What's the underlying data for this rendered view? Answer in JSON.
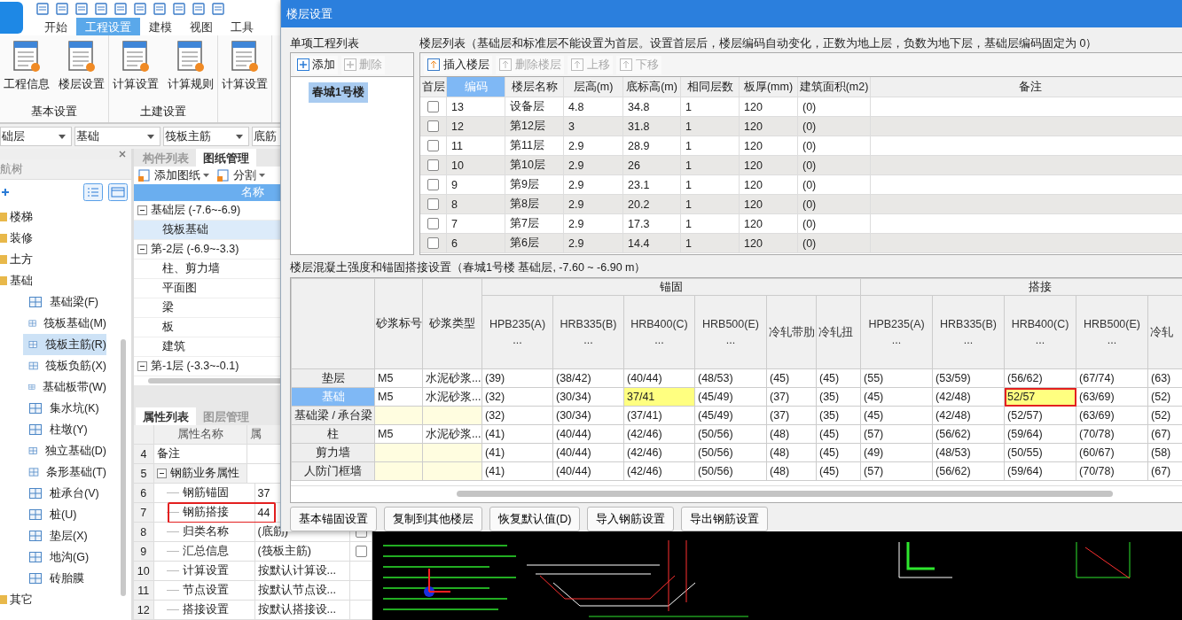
{
  "ribbon_tabs": [
    {
      "label": "开始",
      "selected": false
    },
    {
      "label": "工程设置",
      "selected": true
    },
    {
      "label": "建模",
      "selected": false
    },
    {
      "label": "视图",
      "selected": false
    },
    {
      "label": "工具",
      "selected": false
    }
  ],
  "ribbon_groups": [
    {
      "title": "基本设置",
      "buttons": [
        "工程信息",
        "楼层设置"
      ]
    },
    {
      "title": "土建设置",
      "buttons": [
        "计算设置",
        "计算规则"
      ]
    },
    {
      "buttons": [
        "计算设置"
      ]
    }
  ],
  "selectors": [
    "础层",
    "基础",
    "筏板主筋",
    "底筋"
  ],
  "nav_tree": {
    "title": "航树",
    "items": [
      {
        "label": "楼梯"
      },
      {
        "label": "装修"
      },
      {
        "label": "土方"
      },
      {
        "label": "基础",
        "children": [
          {
            "label": "基础梁(F)",
            "selected": false
          },
          {
            "label": "筏板基础(M)",
            "selected": false
          },
          {
            "label": "筏板主筋(R)",
            "selected": true
          },
          {
            "label": "筏板负筋(X)",
            "selected": false
          },
          {
            "label": "基础板带(W)",
            "selected": false
          },
          {
            "label": "集水坑(K)",
            "selected": false
          },
          {
            "label": "柱墩(Y)",
            "selected": false
          },
          {
            "label": "独立基础(D)",
            "selected": false
          },
          {
            "label": "条形基础(T)",
            "selected": false
          },
          {
            "label": "桩承台(V)",
            "selected": false
          },
          {
            "label": "桩(U)",
            "selected": false
          },
          {
            "label": "垫层(X)",
            "selected": false
          },
          {
            "label": "地沟(G)",
            "selected": false
          },
          {
            "label": "砖胎膜",
            "selected": false
          }
        ]
      },
      {
        "label": "其它"
      }
    ]
  },
  "drawing_panel": {
    "tabs": [
      {
        "label": "构件列表",
        "selected": false
      },
      {
        "label": "图纸管理",
        "selected": true
      }
    ],
    "toolbar": [
      "添加图纸",
      "分割"
    ],
    "column": "名称",
    "tree": [
      {
        "label": "基础层 (-7.6~-6.9)",
        "expanded": true,
        "children": [
          {
            "label": "筏板基础",
            "selected": true
          }
        ]
      },
      {
        "label": "第-2层 (-6.9~-3.3)",
        "expanded": true,
        "children": [
          {
            "label": "柱、剪力墙",
            "selected": false
          },
          {
            "label": "平面图",
            "selected": false
          },
          {
            "label": "梁",
            "selected": false
          },
          {
            "label": "板",
            "selected": false
          },
          {
            "label": "建筑",
            "selected": false
          }
        ]
      },
      {
        "label": "第-1层 (-3.3~-0.1)",
        "expanded": true
      }
    ]
  },
  "properties_panel": {
    "tabs": [
      {
        "label": "属性列表",
        "selected": true
      },
      {
        "label": "图层管理",
        "selected": false
      }
    ],
    "columns": [
      "属性名称",
      "属"
    ],
    "rows": [
      {
        "no": "4",
        "name": "备注",
        "kind": "plain"
      },
      {
        "no": "5",
        "name": "钢筋业务属性",
        "kind": "group",
        "expanded": true
      },
      {
        "no": "6",
        "name": "钢筋锚固",
        "value": "37",
        "kind": "child"
      },
      {
        "no": "7",
        "name": "钢筋搭接",
        "value": "44",
        "kind": "child",
        "marked": true
      },
      {
        "no": "8",
        "name": "归类名称",
        "value": "(底筋)",
        "kind": "child",
        "checked": false
      },
      {
        "no": "9",
        "name": "汇总信息",
        "value": "(筏板主筋)",
        "kind": "child",
        "checked": false
      },
      {
        "no": "10",
        "name": "计算设置",
        "value": "按默认计算设...",
        "kind": "child"
      },
      {
        "no": "11",
        "name": "节点设置",
        "value": "按默认节点设...",
        "kind": "child"
      },
      {
        "no": "12",
        "name": "搭接设置",
        "value": "按默认搭接设...",
        "kind": "child"
      }
    ]
  },
  "floor_dialog": {
    "title": "楼层设置",
    "project_list": {
      "title": "单项工程列表",
      "toolbar": [
        {
          "label": "添加",
          "disabled": false
        },
        {
          "label": "删除",
          "disabled": true
        }
      ],
      "items": [
        {
          "label": "春城1号楼",
          "selected": true
        }
      ]
    },
    "floor_list": {
      "title": "楼层列表（基础层和标准层不能设置为首层。设置首层后，楼层编码自动变化，正数为地上层，负数为地下层，基础层编码固定为 0）",
      "toolbar": [
        {
          "label": "插入楼层",
          "disabled": false
        },
        {
          "label": "删除楼层",
          "disabled": true
        },
        {
          "label": "上移",
          "disabled": true
        },
        {
          "label": "下移",
          "disabled": true
        }
      ],
      "check_column": {
        "label": "首层",
        "selected": false
      },
      "columns": [
        {
          "label": "编码",
          "selected": true
        },
        {
          "label": "楼层名称",
          "selected": false
        },
        {
          "label": "层高(m)",
          "selected": false
        },
        {
          "label": "底标高(m)",
          "selected": false
        },
        {
          "label": "相同层数",
          "selected": false
        },
        {
          "label": "板厚(mm)",
          "selected": false
        },
        {
          "label": "建筑面积(m2)",
          "selected": false
        },
        {
          "label": "备注",
          "selected": false
        }
      ],
      "rows": [
        {
          "first_floor": false,
          "cells": [
            "13",
            "设备层",
            "4.8",
            "34.8",
            "1",
            "120",
            "(0)"
          ]
        },
        {
          "first_floor": false,
          "cells": [
            "12",
            "第12层",
            "3",
            "31.8",
            "1",
            "120",
            "(0)"
          ]
        },
        {
          "first_floor": false,
          "cells": [
            "11",
            "第11层",
            "2.9",
            "28.9",
            "1",
            "120",
            "(0)"
          ]
        },
        {
          "first_floor": false,
          "cells": [
            "10",
            "第10层",
            "2.9",
            "26",
            "1",
            "120",
            "(0)"
          ]
        },
        {
          "first_floor": false,
          "cells": [
            "9",
            "第9层",
            "2.9",
            "23.1",
            "1",
            "120",
            "(0)"
          ]
        },
        {
          "first_floor": false,
          "cells": [
            "8",
            "第8层",
            "2.9",
            "20.2",
            "1",
            "120",
            "(0)"
          ]
        },
        {
          "first_floor": false,
          "cells": [
            "7",
            "第7层",
            "2.9",
            "17.3",
            "1",
            "120",
            "(0)"
          ]
        },
        {
          "first_floor": false,
          "cells": [
            "6",
            "第6层",
            "2.9",
            "14.4",
            "1",
            "120",
            "(0)"
          ]
        }
      ]
    },
    "settings": {
      "title": "楼层混凝土强度和锚固搭接设置（春城1号楼  基础层, -7.60 ~ -6.90 m）",
      "fixed_columns": [
        "砂浆标号",
        "砂浆类型"
      ],
      "groups": [
        {
          "label": "锚固",
          "columns": [
            {
              "label": "HPB235(A)",
              "more": "..."
            },
            {
              "label": "HRB335(B)",
              "more": "..."
            },
            {
              "label": "HRB400(C)",
              "more": "..."
            },
            {
              "label": "HRB500(E)",
              "more": "..."
            },
            {
              "label": "冷轧带肋"
            },
            {
              "label": "冷轧扭"
            }
          ]
        },
        {
          "label": "搭接",
          "columns": [
            {
              "label": "HPB235(A)",
              "more": "..."
            },
            {
              "label": "HRB335(B)",
              "more": "..."
            },
            {
              "label": "HRB400(C)",
              "more": "..."
            },
            {
              "label": "HRB500(E)",
              "more": "..."
            },
            {
              "label": "冷轧"
            }
          ]
        }
      ],
      "rows": [
        {
          "label": "垫层",
          "selected": false,
          "mortar_grade": "M5",
          "mortar_type": "水泥砂浆...",
          "cells": [
            "(39)",
            "(38/42)",
            "(40/44)",
            "(48/53)",
            "(45)",
            "(45)",
            "(55)",
            "(53/59)",
            "(56/62)",
            "(67/74)",
            "(63)"
          ]
        },
        {
          "label": "基础",
          "selected": true,
          "mortar_grade": "M5",
          "mortar_type": "水泥砂浆...",
          "cells": [
            "(32)",
            "(30/34)",
            {
              "text": "37/41",
              "edited": true,
              "marked": false
            },
            "(45/49)",
            "(37)",
            "(35)",
            "(45)",
            "(42/48)",
            {
              "text": "52/57",
              "edited": true,
              "marked": true
            },
            "(63/69)",
            "(52)"
          ]
        },
        {
          "label": "基础梁 / 承台梁",
          "selected": false,
          "cells": [
            "(32)",
            "(30/34)",
            "(37/41)",
            "(45/49)",
            "(37)",
            "(35)",
            "(45)",
            "(42/48)",
            "(52/57)",
            "(63/69)",
            "(52)"
          ]
        },
        {
          "label": "柱",
          "selected": false,
          "mortar_grade": "M5",
          "mortar_type": "水泥砂浆...",
          "cells": [
            "(41)",
            "(40/44)",
            "(42/46)",
            "(50/56)",
            "(48)",
            "(45)",
            "(57)",
            "(56/62)",
            "(59/64)",
            "(70/78)",
            "(67)"
          ]
        },
        {
          "label": "剪力墙",
          "selected": false,
          "cells": [
            "(41)",
            "(40/44)",
            "(42/46)",
            "(50/56)",
            "(48)",
            "(45)",
            "(49)",
            "(48/53)",
            "(50/55)",
            "(60/67)",
            "(58)"
          ]
        },
        {
          "label": "人防门框墙",
          "selected": false,
          "cells": [
            "(41)",
            "(40/44)",
            "(42/46)",
            "(50/56)",
            "(48)",
            "(45)",
            "(57)",
            "(56/62)",
            "(59/64)",
            "(70/78)",
            "(67)"
          ]
        }
      ]
    },
    "buttons": [
      "基本锚固设置",
      "复制到其他楼层",
      "恢复默认值(D)",
      "导入钢筋设置",
      "导出钢筋设置"
    ]
  }
}
